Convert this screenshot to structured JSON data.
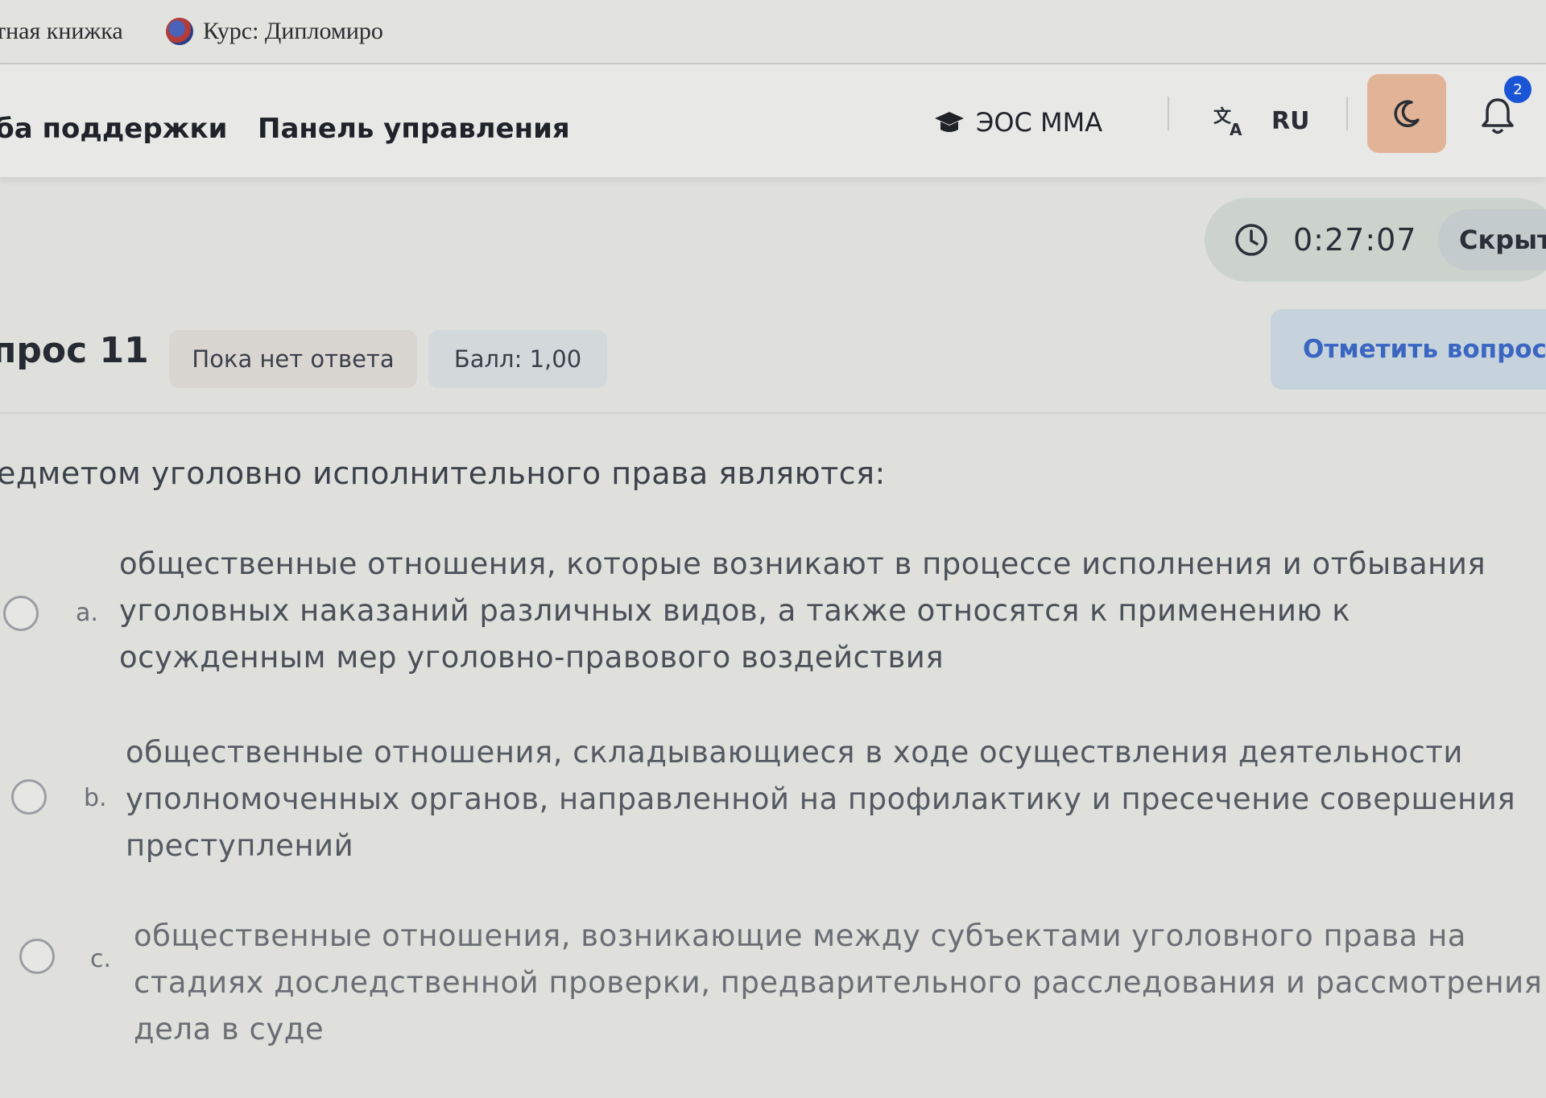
{
  "browser": {
    "bookmarks": [
      {
        "label": "тная книжка"
      },
      {
        "label": "Курс: Дипломиро"
      }
    ]
  },
  "topnav": {
    "support_label": "ба поддержки",
    "panel_label": "Панель управления",
    "eos_label": "ЭОС ММА",
    "lang_label": "RU",
    "notifications_count": "2"
  },
  "timer": {
    "value": "0:27:07",
    "hide_label": "Скрыт"
  },
  "question": {
    "title": "прос 11",
    "status": "Пока нет ответа",
    "score": "Балл: 1,00",
    "flag_label": "Отметить вопрос",
    "text": "едметом уголовно исполнительного права являются:",
    "answers": [
      {
        "letter": "a.",
        "text": "общественные отношения, которые возникают в процессе исполнения и отбывания уголовных наказаний различных видов, а также относятся к применению к осужденным мер уголовно-правового воздействия"
      },
      {
        "letter": "b.",
        "text": "общественные отношения, складывающиеся в ходе осуществления деятельности уполномоченных органов, направленной на профилактику и пресечение совершения преступлений"
      },
      {
        "letter": "c.",
        "text": "общественные отношения, возникающие между субъектами уголовного права на стадиях доследственной проверки, предварительного расследования и рассмотрения дела в суде"
      }
    ]
  },
  "icons": {
    "bookmark_course": "globe-icon",
    "eos": "graduation-cap-icon",
    "translate": "translate-icon",
    "theme": "moon-icon",
    "notifications": "bell-icon",
    "timer": "clock-icon"
  },
  "colors": {
    "accent_link": "#3a66c2",
    "theme_button": "#e2b497",
    "badge_blue": "#1a55d6"
  }
}
